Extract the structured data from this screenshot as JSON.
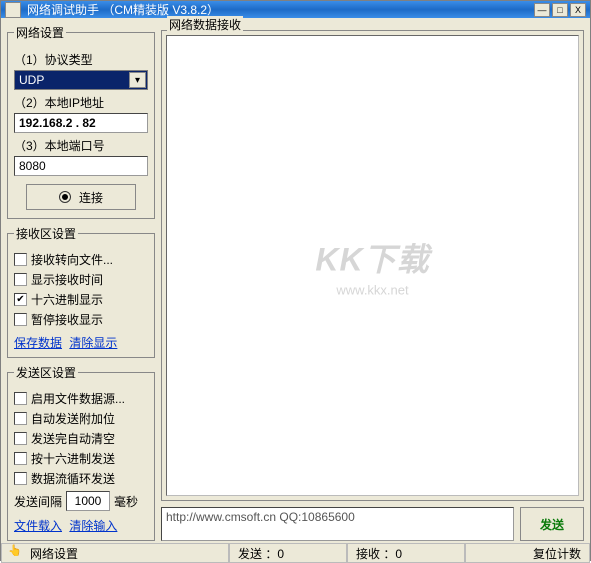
{
  "window": {
    "title": "网络调试助手 （CM精装版 V3.8.2）",
    "buttons": {
      "min": "—",
      "max": "□",
      "close": "X"
    }
  },
  "net_settings": {
    "legend": "网络设置",
    "protocol_label": "（1）协议类型",
    "protocol_value": "UDP",
    "ip_label": "（2）本地IP地址",
    "ip_value": "192.168.2 . 82",
    "port_label": "（3）本地端口号",
    "port_value": "8080",
    "connect_btn": "连接"
  },
  "rx_settings": {
    "legend": "接收区设置",
    "opts": [
      {
        "label": "接收转向文件...",
        "checked": false
      },
      {
        "label": "显示接收时间",
        "checked": false
      },
      {
        "label": "十六进制显示",
        "checked": true
      },
      {
        "label": "暂停接收显示",
        "checked": false
      }
    ],
    "links": {
      "save": "保存数据",
      "clear": "清除显示"
    }
  },
  "tx_settings": {
    "legend": "发送区设置",
    "opts": [
      {
        "label": "启用文件数据源...",
        "checked": false
      },
      {
        "label": "自动发送附加位",
        "checked": false
      },
      {
        "label": "发送完自动清空",
        "checked": false
      },
      {
        "label": "按十六进制发送",
        "checked": false
      },
      {
        "label": "数据流循环发送",
        "checked": false
      }
    ],
    "interval": {
      "prefix": "发送间隔",
      "value": "1000",
      "suffix": "毫秒"
    },
    "links": {
      "load": "文件载入",
      "clear": "清除输入"
    }
  },
  "rx_panel": {
    "legend": "网络数据接收",
    "watermark_main": "KK下载",
    "watermark_sub": "www.kkx.net"
  },
  "send": {
    "input_value": "http://www.cmsoft.cn QQ:10865600",
    "btn_label": "发送"
  },
  "status": {
    "left_label": "网络设置",
    "tx": "发送 ：0",
    "rx": "接收 ：0",
    "reset": "复位计数"
  }
}
